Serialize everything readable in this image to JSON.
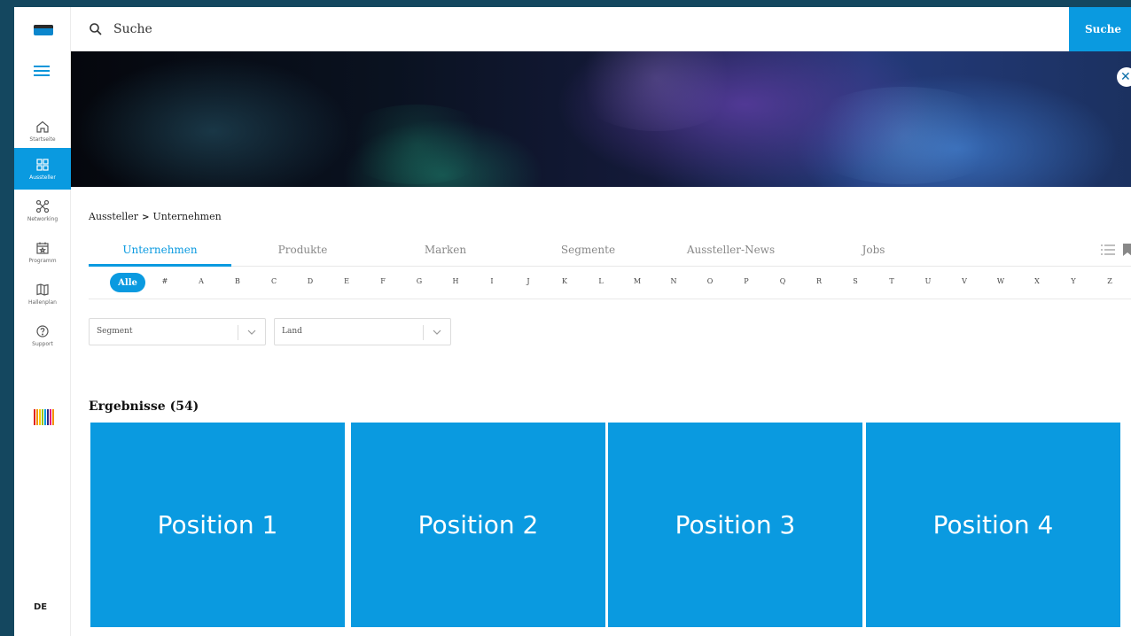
{
  "sidebar": {
    "items": [
      {
        "label": "Startseite",
        "icon": "home-icon"
      },
      {
        "label": "Aussteller",
        "icon": "exhibitors-grid-icon"
      },
      {
        "label": "Networking",
        "icon": "network-icon"
      },
      {
        "label": "Programm",
        "icon": "calendar-icon"
      },
      {
        "label": "Hallenplan",
        "icon": "map-icon"
      },
      {
        "label": "Support",
        "icon": "help-icon"
      }
    ],
    "language": "DE"
  },
  "search": {
    "placeholder": "Suche",
    "button_label": "Suche"
  },
  "breadcrumb": {
    "parent": "Aussteller",
    "current": "Unternehmen"
  },
  "tabs": [
    {
      "label": "Unternehmen"
    },
    {
      "label": "Produkte"
    },
    {
      "label": "Marken"
    },
    {
      "label": "Segmente"
    },
    {
      "label": "Aussteller-News"
    },
    {
      "label": "Jobs"
    }
  ],
  "alphabet": {
    "all_label": "Alle",
    "letters": [
      "#",
      "A",
      "B",
      "C",
      "D",
      "E",
      "F",
      "G",
      "H",
      "I",
      "J",
      "K",
      "L",
      "M",
      "N",
      "O",
      "P",
      "Q",
      "R",
      "S",
      "T",
      "U",
      "V",
      "W",
      "X",
      "Y",
      "Z"
    ]
  },
  "filters": {
    "segment_placeholder": "Segment",
    "land_placeholder": "Land"
  },
  "results": {
    "title": "Ergebnisse (54)",
    "cards": [
      {
        "label": "Position 1"
      },
      {
        "label": "Position 2"
      },
      {
        "label": "Position 3"
      },
      {
        "label": "Position 4"
      }
    ]
  },
  "colors": {
    "accent": "#0a9ae0",
    "background": "#14475f"
  }
}
